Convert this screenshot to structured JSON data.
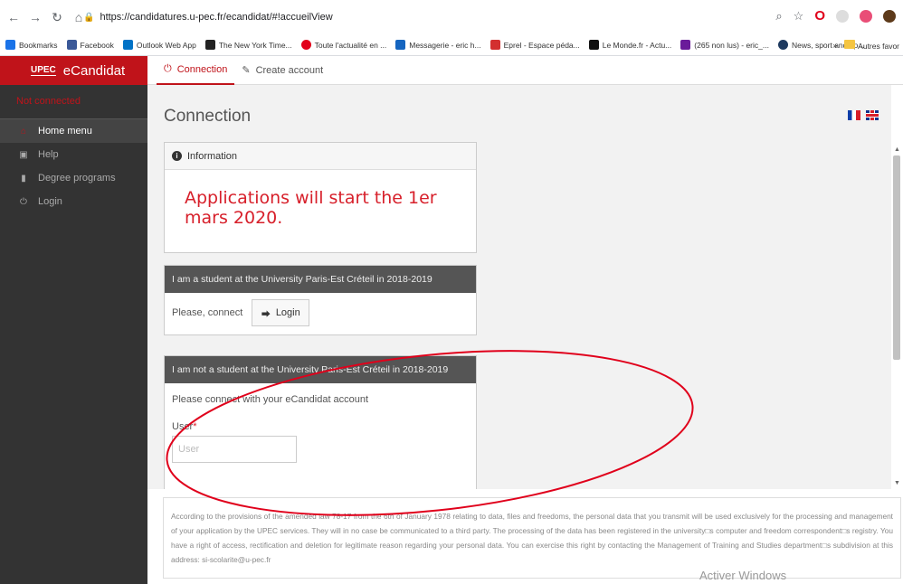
{
  "browser": {
    "url": "https://candidatures.u-pec.fr/ecandidat/#!accueilView",
    "bookmarks": [
      {
        "label": "Bookmarks",
        "color": "#1a73e8"
      },
      {
        "label": "Facebook",
        "color": "#3b5998"
      },
      {
        "label": "Outlook Web App",
        "color": "#0072c6"
      },
      {
        "label": "The New York Time...",
        "color": "#222222"
      },
      {
        "label": "Toute l'actualité en ...",
        "color": "#e2001a"
      },
      {
        "label": "Messagerie - eric h...",
        "color": "#1565c0"
      },
      {
        "label": "Eprel - Espace péda...",
        "color": "#d32f2f"
      },
      {
        "label": "Le Monde.fr - Actu...",
        "color": "#111111"
      },
      {
        "label": "(265 non lus) - eric_...",
        "color": "#6a1b9a"
      },
      {
        "label": "News, sport and op...",
        "color": "#1e3a5f"
      }
    ],
    "more": "»",
    "other_bookmarks": "Autres favor"
  },
  "app": {
    "brand_logo": "UPEC",
    "brand": "eCandidat",
    "status": "Not connected",
    "menu": [
      {
        "label": "Home menu",
        "icon": "home-icon",
        "glyph": "⌂"
      },
      {
        "label": "Help",
        "icon": "help-icon",
        "glyph": "▣"
      },
      {
        "label": "Degree programs",
        "icon": "bookmark-icon",
        "glyph": "▮"
      },
      {
        "label": "Login",
        "icon": "power-icon",
        "glyph": "⏻"
      }
    ],
    "tabs": [
      {
        "label": "Connection",
        "glyph": "⏻"
      },
      {
        "label": "Create account",
        "glyph": "✎"
      }
    ]
  },
  "main": {
    "title": "Connection",
    "information_header": "Information",
    "announcement": "Applications will start the 1er mars 2020.",
    "student_header": "I am a student at the University Paris-Est Créteil in 2018-2019",
    "student_prompt": "Please, connect",
    "login_button": "Login",
    "non_student_header": "I am not a student at the University Paris-Est Créteil in 2018-2019",
    "connect_prompt": "Please connect with your eCandidat account",
    "user_label": "User",
    "required_mark": "*",
    "user_placeholder": "User"
  },
  "footer": {
    "text": "According to the provisions of the amended law 78-17 from the 6th of January 1978 relating to data, files and freedoms, the personal data that you transmit will be used exclusively for the processing and management of your application by the UPEC services. They will in no case be communicated to a third party. The processing of the data has been registered in the university□s computer and freedom correspondent□s registry. You have a right of access, rectification and deletion for legitimate reason regarding your personal data. You can exercise this right by contacting the Management of Training and Studies department□s subdivision at this address: si-scolarite@u-pec.fr"
  },
  "watermark": "Activer Windows",
  "colors": {
    "accent": "#c0131a",
    "annotation": "#e0001b"
  }
}
